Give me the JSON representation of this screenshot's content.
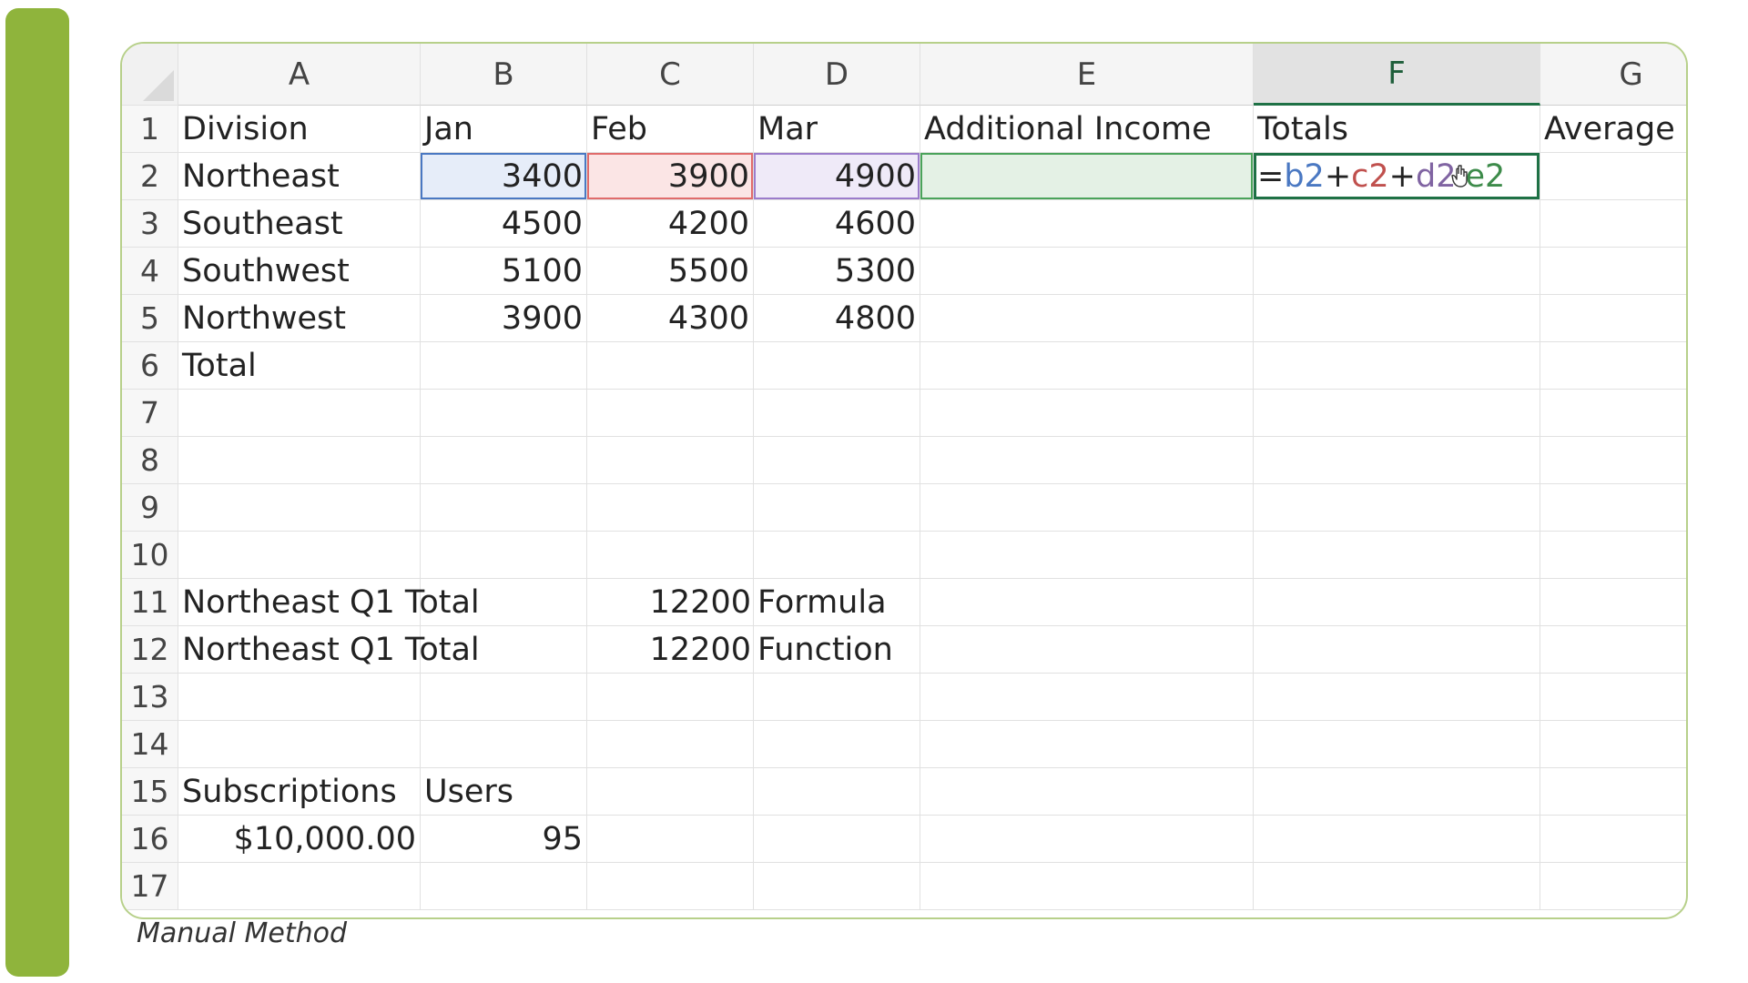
{
  "sheet": {
    "columns": [
      "A",
      "B",
      "C",
      "D",
      "E",
      "F",
      "G"
    ],
    "row_numbers": [
      "1",
      "2",
      "3",
      "4",
      "5",
      "6",
      "7",
      "8",
      "9",
      "10",
      "11",
      "12",
      "13",
      "14",
      "15",
      "16",
      "17"
    ],
    "header_row": {
      "a": "Division",
      "b": "Jan",
      "c": "Feb",
      "d": "Mar",
      "e": "Additional Income",
      "f": "Totals",
      "g": "Average"
    },
    "divisions": [
      {
        "name": "Northeast",
        "jan": "3400",
        "feb": "3900",
        "mar": "4900"
      },
      {
        "name": "Southeast",
        "jan": "4500",
        "feb": "4200",
        "mar": "4600"
      },
      {
        "name": "Southwest",
        "jan": "5100",
        "feb": "5500",
        "mar": "5300"
      },
      {
        "name": "Northwest",
        "jan": "3900",
        "feb": "4300",
        "mar": "4800"
      }
    ],
    "total_label": "Total",
    "q1_rows": [
      {
        "label": "Northeast Q1 Total",
        "value": "12200",
        "method": "Formula"
      },
      {
        "label": "Northeast Q1 Total",
        "value": "12200",
        "method": "Function"
      }
    ],
    "subscriptions": {
      "label_a": "Subscriptions",
      "label_b": "Users",
      "value_a": "$10,000.00",
      "value_b": "95"
    },
    "formula_parts": {
      "eq": "=",
      "ref1": "b2",
      "plus1": "+",
      "ref2": "c2",
      "plus2": "+",
      "ref3": "d2",
      "ref4": "e2"
    }
  },
  "caption": "Manual Method",
  "colors": {
    "accent": "#8fb43c",
    "ref_blue": "#4a78c2",
    "ref_red": "#c0504d",
    "ref_purple": "#8064a2",
    "ref_green": "#3d8b4a",
    "active_border": "#1e7145"
  },
  "icons": {
    "cursor": "move-cursor-icon"
  }
}
